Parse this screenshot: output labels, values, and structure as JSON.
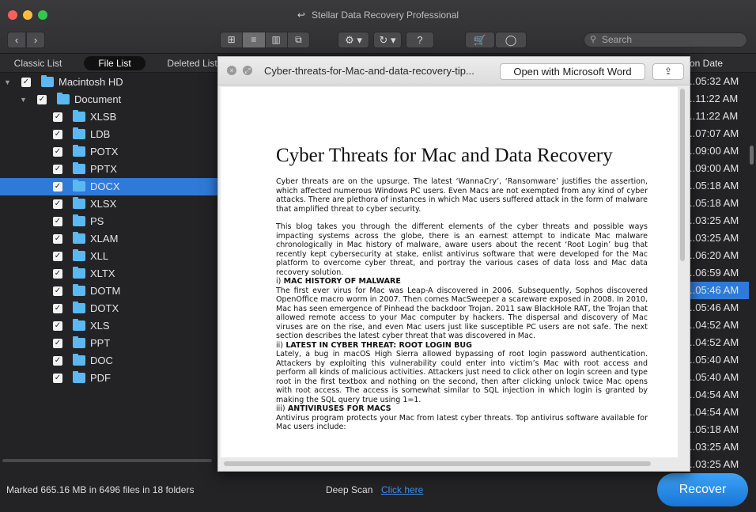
{
  "window": {
    "title": "Stellar Data Recovery Professional"
  },
  "toolbar": {
    "back_glyph": "‹",
    "forward_glyph": "›",
    "view_icons": [
      "⊞",
      "≡",
      "▥",
      "⧉"
    ],
    "gear_glyph": "⚙ ▾",
    "history_glyph": "↻ ▾",
    "help_glyph": "?",
    "cart_glyph": "🛒",
    "user_glyph": "◯",
    "search_placeholder": "Search",
    "search_icon": "🔍"
  },
  "tabs": {
    "classic": "Classic List",
    "file": "File List",
    "deleted": "Deleted List"
  },
  "tree": {
    "root": "Macintosh HD",
    "document": "Document",
    "folders": [
      "XLSB",
      "LDB",
      "POTX",
      "PPTX",
      "DOCX",
      "XLSX",
      "PS",
      "XLAM",
      "XLL",
      "XLTX",
      "DOTM",
      "DOTX",
      "XLS",
      "PPT",
      "DOC",
      "PDF"
    ],
    "selected": "DOCX"
  },
  "right_column": {
    "header": "on Date",
    "times": [
      "..05:32 AM",
      "..11:22 AM",
      "..11:22 AM",
      "..07:07 AM",
      "..09:00 AM",
      "..09:00 AM",
      "..05:18 AM",
      "..05:18 AM",
      "..03:25 AM",
      "..03:25 AM",
      "..06:20 AM",
      "..06:59 AM",
      "..05:46 AM",
      "..05:46 AM",
      "..04:52 AM",
      "..04:52 AM",
      "..05:40 AM",
      "..05:40 AM",
      "..04:54 AM",
      "..04:54 AM",
      "..05:18 AM",
      "..03:25 AM",
      "..03:25 AM"
    ],
    "selected_index": 12
  },
  "preview": {
    "filename": "Cyber-threats-for-Mac-and-data-recovery-tip...",
    "open_button": "Open with Microsoft Word",
    "share_glyph": "⇪",
    "close_glyph": "×",
    "doc": {
      "title": "Cyber Threats for Mac and Data Recovery",
      "p1": "Cyber threats are on the upsurge. The latest ‘WannaCry’, ‘Ransomware’ justifies the assertion, which affected numerous Windows PC users. Even Macs are not exempted from any kind of cyber attacks. There are plethora of instances in which Mac users suffered attack in the form of malware that amplified threat to cyber security.",
      "p2": "This blog takes you through the different elements of the cyber threats and possible ways impacting systems across the globe, there is an earnest attempt to indicate Mac malware chronologically in Mac history of malware, aware users about the recent ‘Root Login’ bug that recently kept cybersecurity at stake, enlist antivirus software that were developed for the Mac platform to overcome cyber threat, and portray the various cases of data loss and Mac data recovery solution.",
      "h1_num": "i)",
      "h1": "MAC HISTORY OF MALWARE",
      "p3": "The first ever virus for Mac was Leap-A discovered in 2006. Subsequently, Sophos discovered OpenOffice macro worm in 2007. Then comes MacSweeper a scareware exposed in 2008. In 2010, Mac has seen emergence of Pinhead the backdoor Trojan. 2011 saw BlackHole RAT, the Trojan that allowed remote access to your Mac computer by hackers. The dispersal and discovery of Mac viruses are on the rise, and even Mac users just like susceptible PC users are not safe. The next section describes the latest cyber threat that was discovered in Mac.",
      "h2_num": "ii)",
      "h2": "LATEST IN CYBER THREAT: ROOT LOGIN BUG",
      "p4": "Lately, a bug in macOS High Sierra allowed bypassing of root login password authentication. Attackers by exploiting this vulnerability could enter into victim’s Mac with root access and perform all kinds of malicious activities. Attackers just need to click other on login screen and type root in the first textbox and nothing on the second, then after clicking unlock twice Mac opens with root access. The access is somewhat similar to SQL injection in which login is granted by making the SQL query true using 1=1.",
      "h3_num": "iii)",
      "h3": "ANTIVIRUSES FOR MACS",
      "p5": "Antivirus program protects your Mac from latest cyber threats. Top antivirus software available for Mac users include:"
    }
  },
  "bottom": {
    "marked": "Marked 665.16 MB in 6496 files in 18 folders",
    "deep_scan": "Deep Scan",
    "click_here": "Click here",
    "recover": "Recover"
  },
  "colors": {
    "selection": "#2f7ad9",
    "folder": "#5bb8f0",
    "recover": "#2a8ae8"
  }
}
